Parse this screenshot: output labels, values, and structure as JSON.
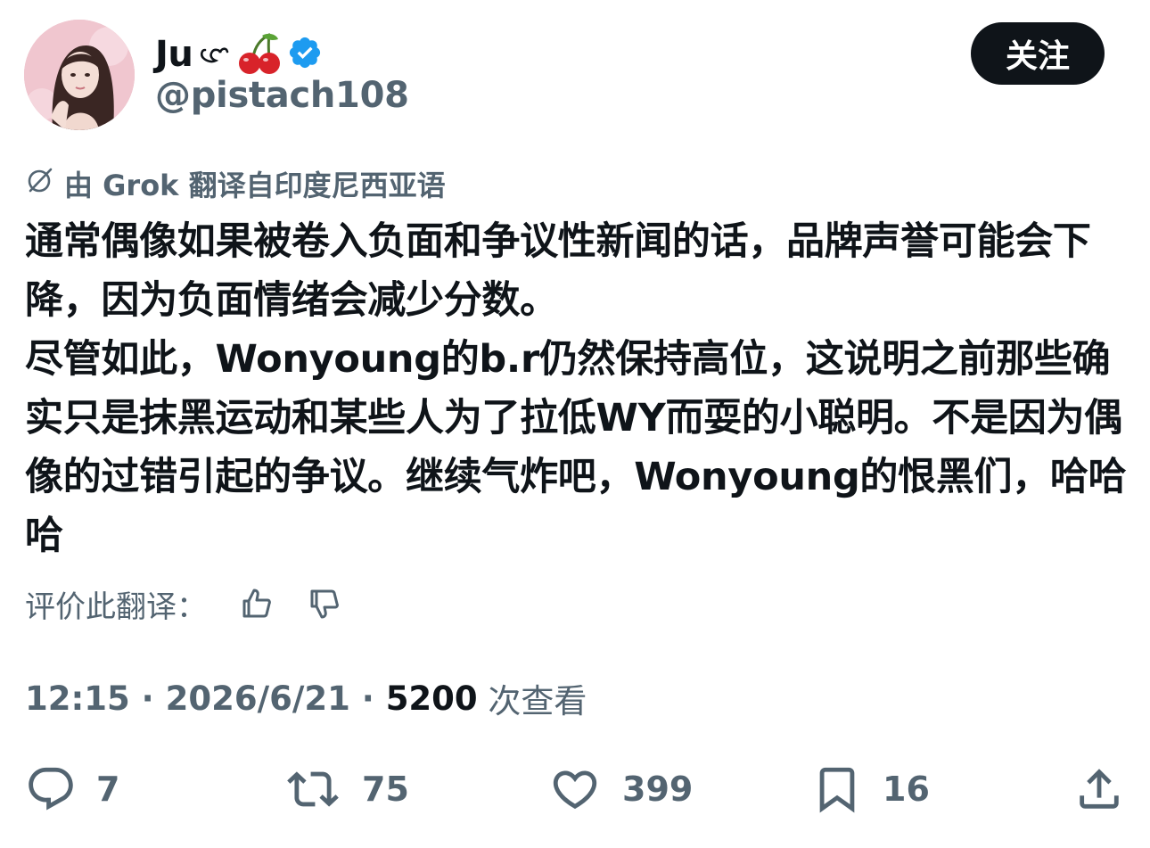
{
  "user": {
    "display_name": "Ju",
    "handle": "@pistach108",
    "verified": true
  },
  "follow_button": {
    "label": "关注"
  },
  "translation": {
    "label": "由 Grok 翻译自印度尼西亚语",
    "rate_label": "评价此翻译："
  },
  "tweet": {
    "paragraph_1": "通常偶像如果被卷入负面和争议性新闻的话，品牌声誉可能会下降，因为负面情绪会减少分数。",
    "paragraph_2": "尽管如此，Wonyoung的b.r仍然保持高位，这说明之前那些确实只是抹黑运动和某些人为了拉低WY而耍的小聪明。不是因为偶像的过错引起的争议。继续气炸吧，Wonyoung的恨黑们，哈哈哈"
  },
  "meta": {
    "time": "12:15",
    "separator": " · ",
    "date": "2026/6/21",
    "views_count": "5200",
    "views_label": " 次查看"
  },
  "actions": {
    "replies": "7",
    "retweets": "75",
    "likes": "399",
    "bookmarks": "16"
  },
  "colors": {
    "text_primary": "#0f1419",
    "text_secondary": "#536471",
    "verified_blue": "#1d9bf0",
    "cherry_red": "#d8232a"
  },
  "icons": [
    "cherry-icon",
    "verified-badge-icon",
    "grok-icon",
    "thumbs-up-icon",
    "thumbs-down-icon",
    "reply-icon",
    "retweet-icon",
    "like-icon",
    "bookmark-icon",
    "share-icon"
  ]
}
